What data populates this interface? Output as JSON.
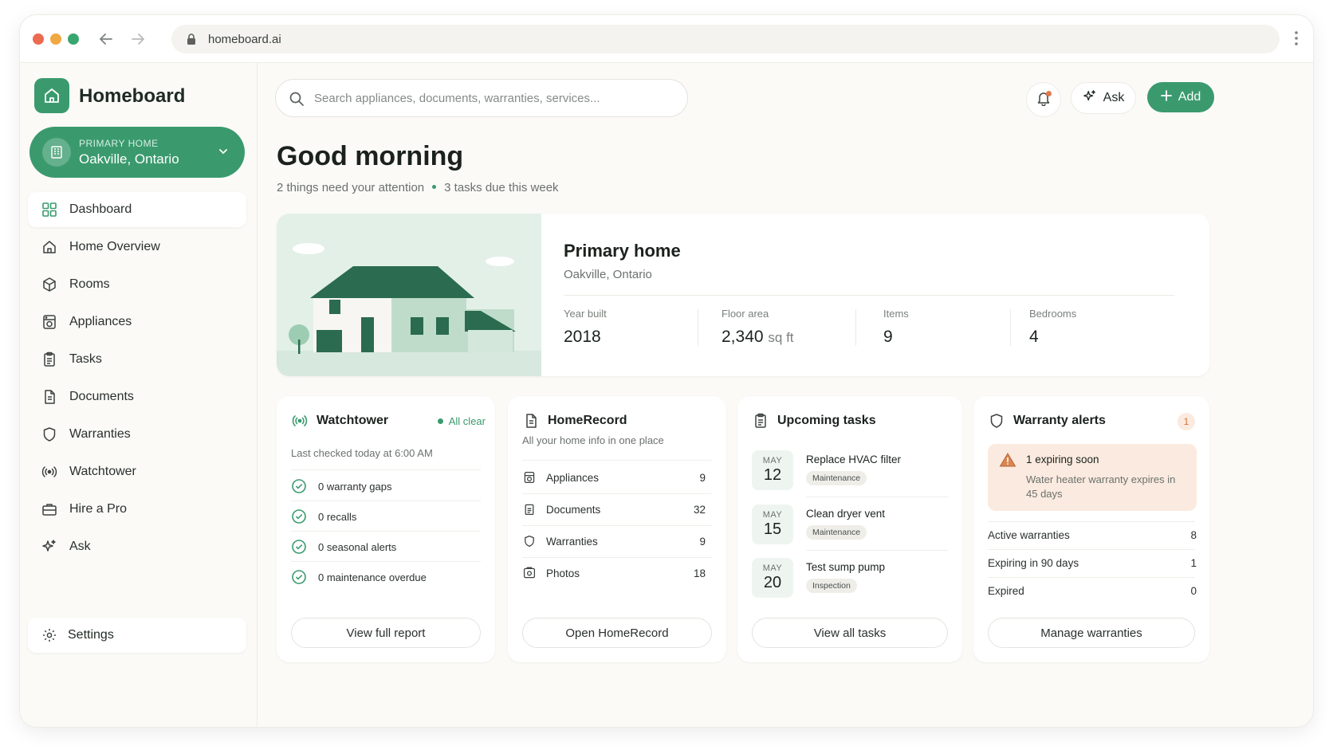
{
  "browser": {
    "url": "homeboard.ai"
  },
  "brand": {
    "name": "Homeboard"
  },
  "home_selector": {
    "label": "PRIMARY HOME",
    "value": "Oakville, Ontario"
  },
  "nav": [
    {
      "label": "Dashboard",
      "icon": "grid-icon",
      "active": true
    },
    {
      "label": "Home Overview",
      "icon": "home-icon"
    },
    {
      "label": "Rooms",
      "icon": "cube-icon"
    },
    {
      "label": "Appliances",
      "icon": "appliance-icon"
    },
    {
      "label": "Tasks",
      "icon": "clipboard-icon"
    },
    {
      "label": "Documents",
      "icon": "document-icon"
    },
    {
      "label": "Warranties",
      "icon": "shield-icon"
    },
    {
      "label": "Watchtower",
      "icon": "signal-icon"
    },
    {
      "label": "Hire a Pro",
      "icon": "briefcase-icon"
    },
    {
      "label": "Ask",
      "icon": "sparkle-icon"
    }
  ],
  "settings": {
    "label": "Settings"
  },
  "search": {
    "placeholder": "Search appliances, documents, warranties, services..."
  },
  "header": {
    "ask_label": "Ask",
    "add_label": "Add"
  },
  "greeting": {
    "title": "Good morning",
    "attention": "2 things need your attention",
    "tasks_due": "3 tasks due this week"
  },
  "hero": {
    "title": "Primary home",
    "location": "Oakville, Ontario",
    "stats": [
      {
        "label": "Year built",
        "value": "2018",
        "unit": ""
      },
      {
        "label": "Floor area",
        "value": "2,340",
        "unit": "sq ft"
      },
      {
        "label": "Items",
        "value": "9",
        "unit": ""
      },
      {
        "label": "Bedrooms",
        "value": "4",
        "unit": ""
      }
    ]
  },
  "watchtower": {
    "title": "Watchtower",
    "status": "All clear",
    "last_checked": "Last checked today at 6:00 AM",
    "items": [
      "0  warranty gaps",
      "0  recalls",
      "0  seasonal alerts",
      "0  maintenance overdue"
    ],
    "button": "View full report"
  },
  "homerecord": {
    "title": "HomeRecord",
    "subtitle": "All your home info in one place",
    "rows": [
      {
        "label": "Appliances",
        "count": "9",
        "icon": "appliance-icon"
      },
      {
        "label": "Documents",
        "count": "32",
        "icon": "document-icon"
      },
      {
        "label": "Warranties",
        "count": "9",
        "icon": "shield-icon"
      },
      {
        "label": "Photos",
        "count": "18",
        "icon": "photo-icon"
      }
    ],
    "button": "Open HomeRecord"
  },
  "upcoming": {
    "title": "Upcoming tasks",
    "tasks": [
      {
        "month": "MAY",
        "day": "12",
        "name": "Replace HVAC filter",
        "tag": "Maintenance"
      },
      {
        "month": "MAY",
        "day": "15",
        "name": "Clean dryer vent",
        "tag": "Maintenance"
      },
      {
        "month": "MAY",
        "day": "20",
        "name": "Test sump pump",
        "tag": "Inspection"
      }
    ],
    "button": "View all tasks"
  },
  "warranty": {
    "title": "Warranty alerts",
    "badge": "1",
    "alert_title": "1 expiring soon",
    "alert_desc": "Water heater warranty expires in 45 days",
    "rows": [
      {
        "label": "Active warranties",
        "count": "8"
      },
      {
        "label": "Expiring in 90 days",
        "count": "1"
      },
      {
        "label": "Expired",
        "count": "0"
      }
    ],
    "button": "Manage warranties"
  },
  "colors": {
    "accent": "#3a9a6e",
    "accent_dark": "#2b6b4f",
    "warning": "#d3743f"
  }
}
